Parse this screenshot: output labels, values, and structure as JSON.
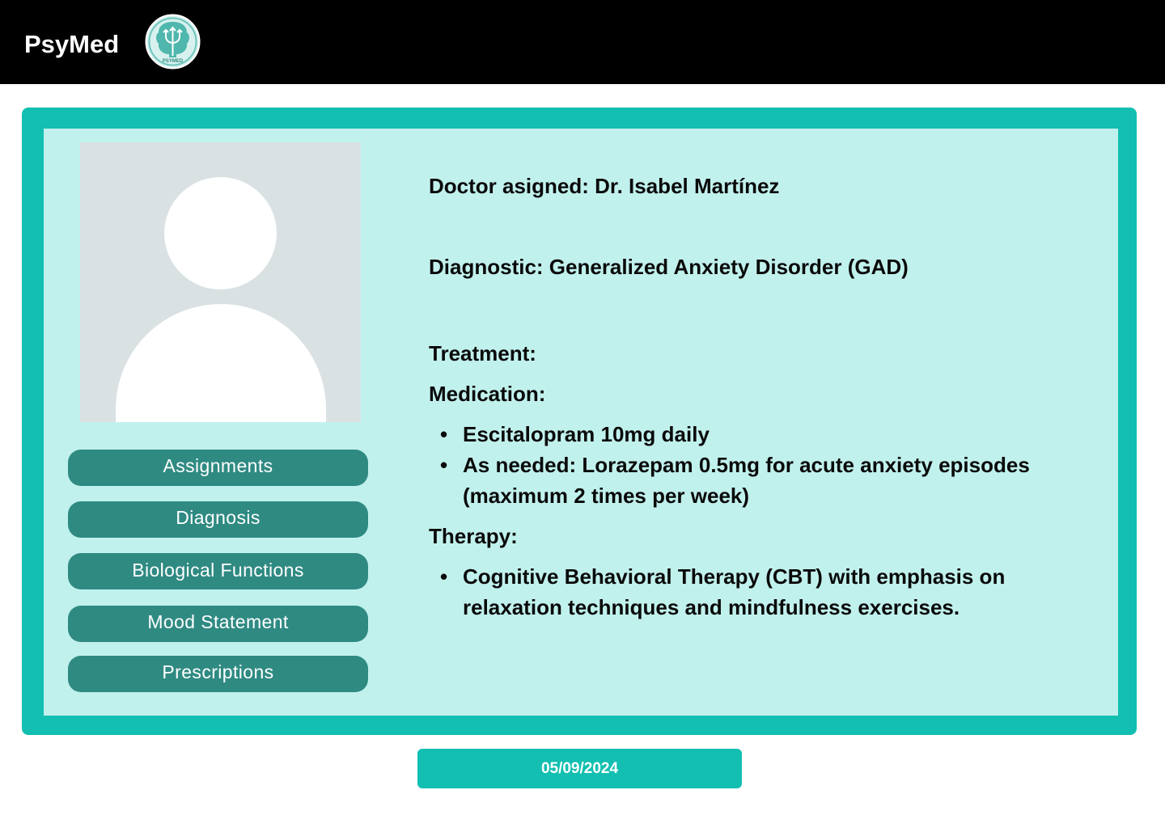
{
  "header": {
    "brand": "PsyMed",
    "logo_text": "PSYMED",
    "logo_symbol": "Ψ"
  },
  "sidebar": {
    "buttons": [
      {
        "label": "Assignments"
      },
      {
        "label": "Diagnosis"
      },
      {
        "label": "Biological Functions"
      },
      {
        "label": "Mood Statement"
      },
      {
        "label": "Prescriptions"
      }
    ]
  },
  "details": {
    "doctor": "Doctor asigned: Dr. Isabel Martínez",
    "diagnostic": "Diagnostic: Generalized Anxiety Disorder (GAD)",
    "treatment_heading": "Treatment:",
    "medication_heading": "Medication:",
    "medications": [
      "Escitalopram 10mg daily",
      "As needed: Lorazepam 0.5mg for acute anxiety episodes (maximum 2 times per week)"
    ],
    "therapy_heading": "Therapy:",
    "therapies": [
      "Cognitive Behavioral Therapy (CBT) with emphasis on relaxation techniques and mindfulness exercises."
    ]
  },
  "footer": {
    "date": "05/09/2024"
  },
  "colors": {
    "topbar": "#000000",
    "card_border": "#12bfb1",
    "card_background": "#c1f1ed",
    "button": "#2f8a82",
    "avatar_background": "#d9e1e3"
  }
}
